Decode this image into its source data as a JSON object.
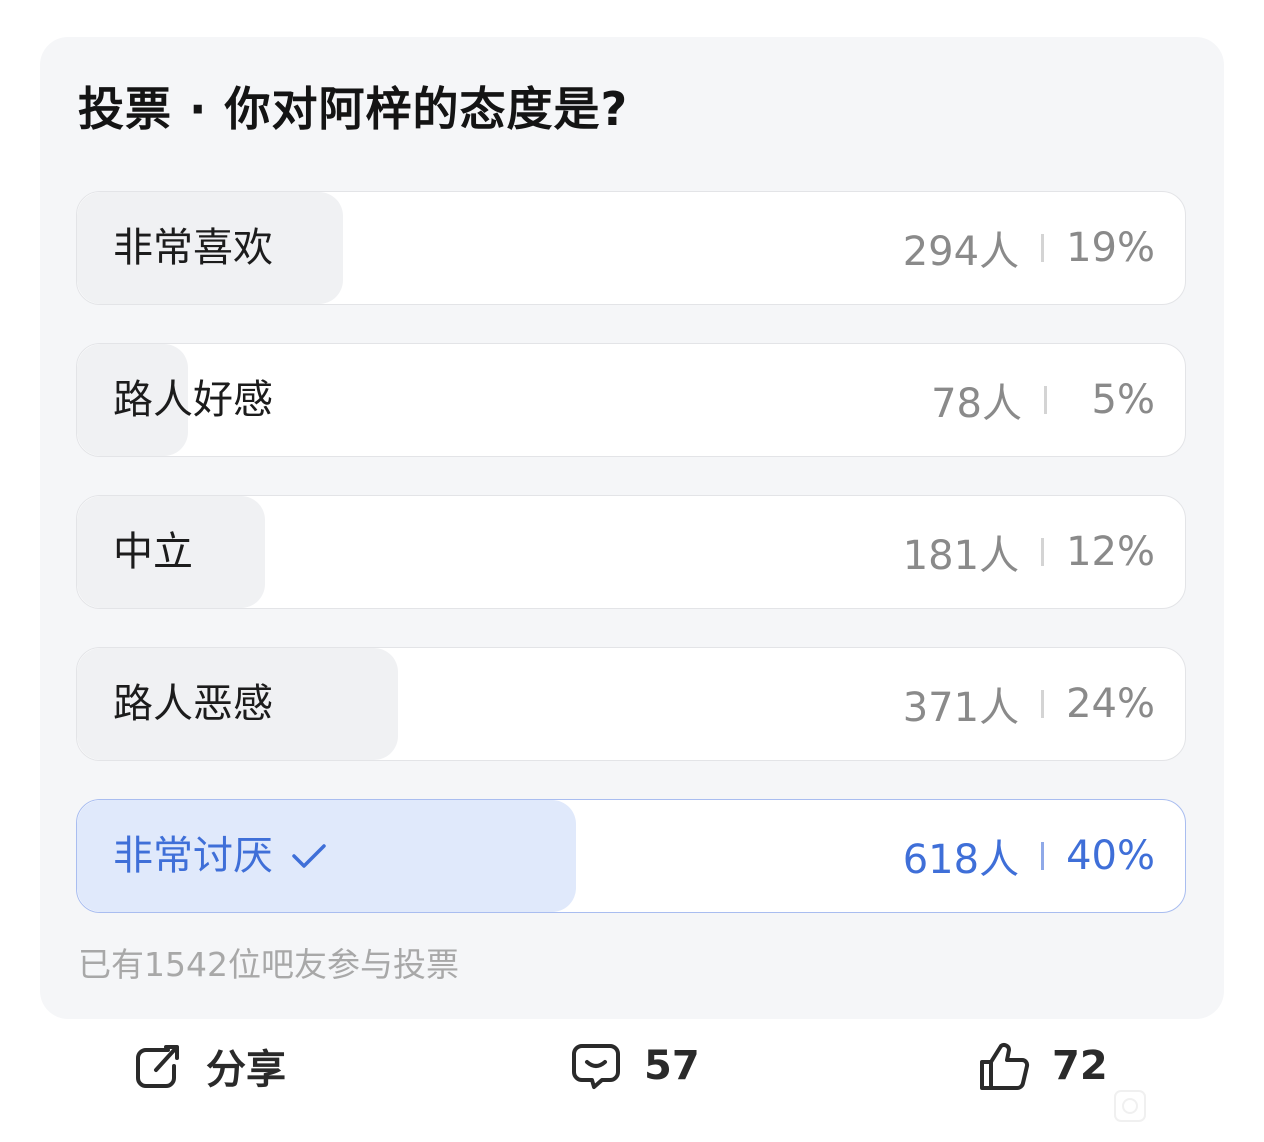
{
  "poll": {
    "title": "投票 · 你对阿梓的态度是?",
    "options": [
      {
        "label": "非常喜欢",
        "count": "294人",
        "percent": "19%",
        "share": 0.19,
        "selected": false
      },
      {
        "label": "路人好感",
        "count": "78人",
        "percent": "5%",
        "share": 0.05,
        "selected": false
      },
      {
        "label": "中立",
        "count": "181人",
        "percent": "12%",
        "share": 0.12,
        "selected": false
      },
      {
        "label": "路人恶感",
        "count": "371人",
        "percent": "24%",
        "share": 0.24,
        "selected": false
      },
      {
        "label": "非常讨厌",
        "count": "618人",
        "percent": "40%",
        "share": 0.4,
        "selected": true
      }
    ],
    "footer": "已有1542位吧友参与投票"
  },
  "actions": {
    "share_label": "分享",
    "comments_count": "57",
    "likes_count": "72"
  },
  "icons": {
    "selected": "check-icon",
    "share": "share-icon",
    "comment": "comment-icon",
    "like": "thumbs-up-icon"
  },
  "colors": {
    "accent": "#3f6fd8",
    "selected_fill": "#e0e9fb",
    "option_fill": "#f0f1f3",
    "card_bg": "#f5f6f8"
  }
}
